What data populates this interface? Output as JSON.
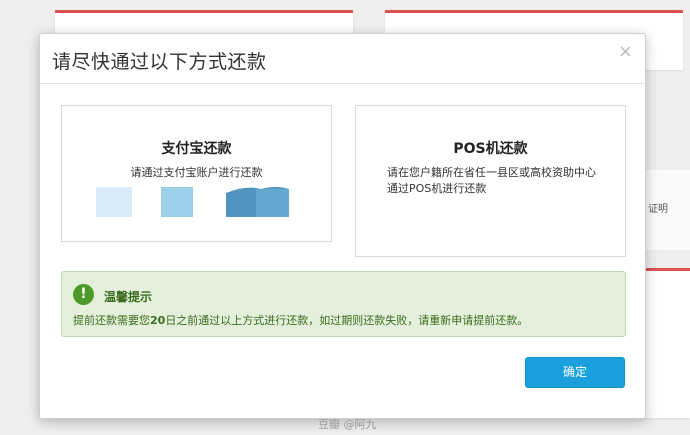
{
  "modal": {
    "title": "请尽快通过以下方式还款",
    "close_glyph": "×",
    "confirm_label": "确定"
  },
  "options": {
    "alipay": {
      "title": "支付宝还款",
      "desc": "请通过支付宝账户进行还款"
    },
    "pos": {
      "title": "POS机还款",
      "desc_line1": "请在您户籍所在省任一县区或高校资助中心",
      "desc_line2": "通过POS机进行还款"
    }
  },
  "tip": {
    "icon_glyph": "!",
    "title": "温馨提示",
    "text_before": "提前还款需要您",
    "text_bold": "20",
    "text_after": "日之前通过以上方式进行还款，如过期则还款失败，请重新申请提前还款。"
  },
  "background": {
    "side_text": "证明"
  },
  "watermark": "豆瓣 @阿九",
  "colors": {
    "accent": "#1aa0dc",
    "tip_bg": "#e4f0db",
    "tip_text": "#3a6b1e",
    "card_border": "#d9534f"
  }
}
